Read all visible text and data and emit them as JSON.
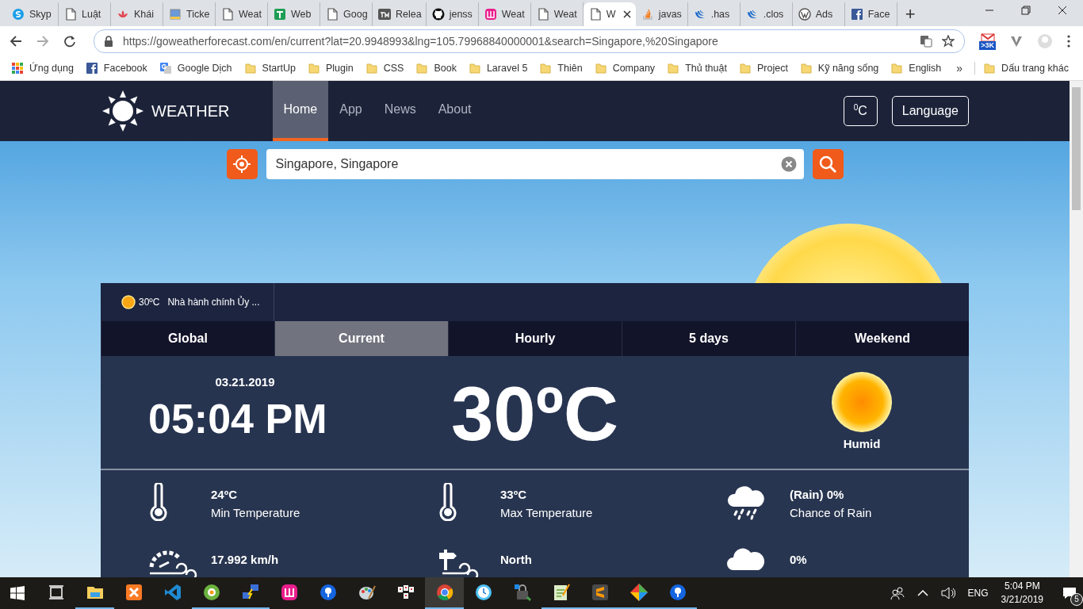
{
  "browser": {
    "tabs": [
      {
        "title": "Skyp",
        "selected": false
      },
      {
        "title": "Luật",
        "selected": false
      },
      {
        "title": "Khái",
        "selected": false
      },
      {
        "title": "Ticke",
        "selected": false
      },
      {
        "title": "Weat",
        "selected": false
      },
      {
        "title": "Web",
        "selected": false
      },
      {
        "title": "Goog",
        "selected": false
      },
      {
        "title": "Relea",
        "selected": false
      },
      {
        "title": "jenss",
        "selected": false
      },
      {
        "title": "Weat",
        "selected": false
      },
      {
        "title": "Weat",
        "selected": false
      },
      {
        "title": "W",
        "selected": true
      },
      {
        "title": "javas",
        "selected": false
      },
      {
        "title": ".has",
        "selected": false
      },
      {
        "title": ".clos",
        "selected": false
      },
      {
        "title": "Ads",
        "selected": false
      },
      {
        "title": "Face",
        "selected": false
      }
    ],
    "new_tab": "+",
    "url": "https://goweatherforecast.com/en/current?lat=20.9948993&lng=105.79968840000001&search=Singapore,%20Singapore",
    "mail_badge": ">3K",
    "bookmarks": [
      "Ứng dụng",
      "Facebook",
      "Google Dịch",
      "StartUp",
      "Plugin",
      "CSS",
      "Book",
      "Laravel 5",
      "Thiên",
      "Company",
      "Thủ thuật",
      "Project",
      "Kỹ năng sống",
      "English"
    ],
    "more": "»",
    "other_bookmarks": "Dấu trang khác"
  },
  "site": {
    "brand": "WEATHER",
    "nav": [
      {
        "label": "Home",
        "selected": true
      },
      {
        "label": "App",
        "selected": false
      },
      {
        "label": "News",
        "selected": false
      },
      {
        "label": "About",
        "selected": false
      }
    ],
    "unit_button": "$^{0}$C",
    "language_button": "Language",
    "search": {
      "value": "Singapore, Singapore"
    },
    "location_tab": {
      "temp": "30ºC",
      "name": "Nhà hành chính Ủy ..."
    },
    "tabs": [
      {
        "label": "Global",
        "selected": false
      },
      {
        "label": "Current",
        "selected": true
      },
      {
        "label": "Hourly",
        "selected": false
      },
      {
        "label": "5 days",
        "selected": false
      },
      {
        "label": "Weekend",
        "selected": false
      }
    ],
    "current": {
      "date": "03.21.2019",
      "time": "05:04 PM",
      "temperature": "30ºC",
      "condition": "Humid"
    },
    "stats": [
      {
        "value": "24ºC",
        "label": "Min Temperature"
      },
      {
        "value": "33ºC",
        "label": "Max Temperature"
      },
      {
        "value": "(Rain) 0%",
        "label": "Chance of Rain"
      },
      {
        "value": "17.992 km/h"
      },
      {
        "value": "North"
      },
      {
        "value": "0%"
      }
    ]
  },
  "taskbar": {
    "apps": [
      {
        "running": false,
        "selected": false
      },
      {
        "running": true,
        "selected": false
      },
      {
        "running": false,
        "selected": false
      },
      {
        "running": false,
        "selected": false
      },
      {
        "running": true,
        "selected": false
      },
      {
        "running": true,
        "selected": false
      },
      {
        "running": false,
        "selected": false
      },
      {
        "running": false,
        "selected": false
      },
      {
        "running": false,
        "selected": false
      },
      {
        "running": false,
        "selected": false
      },
      {
        "running": true,
        "selected": true
      },
      {
        "running": false,
        "selected": false
      },
      {
        "running": false,
        "selected": false
      },
      {
        "running": true,
        "selected": false
      },
      {
        "running": true,
        "selected": false
      },
      {
        "running": true,
        "selected": false
      },
      {
        "running": true,
        "selected": false
      }
    ],
    "language": "ENG",
    "time": "5:04 PM",
    "date": "3/21/2019",
    "notifications": "5"
  }
}
